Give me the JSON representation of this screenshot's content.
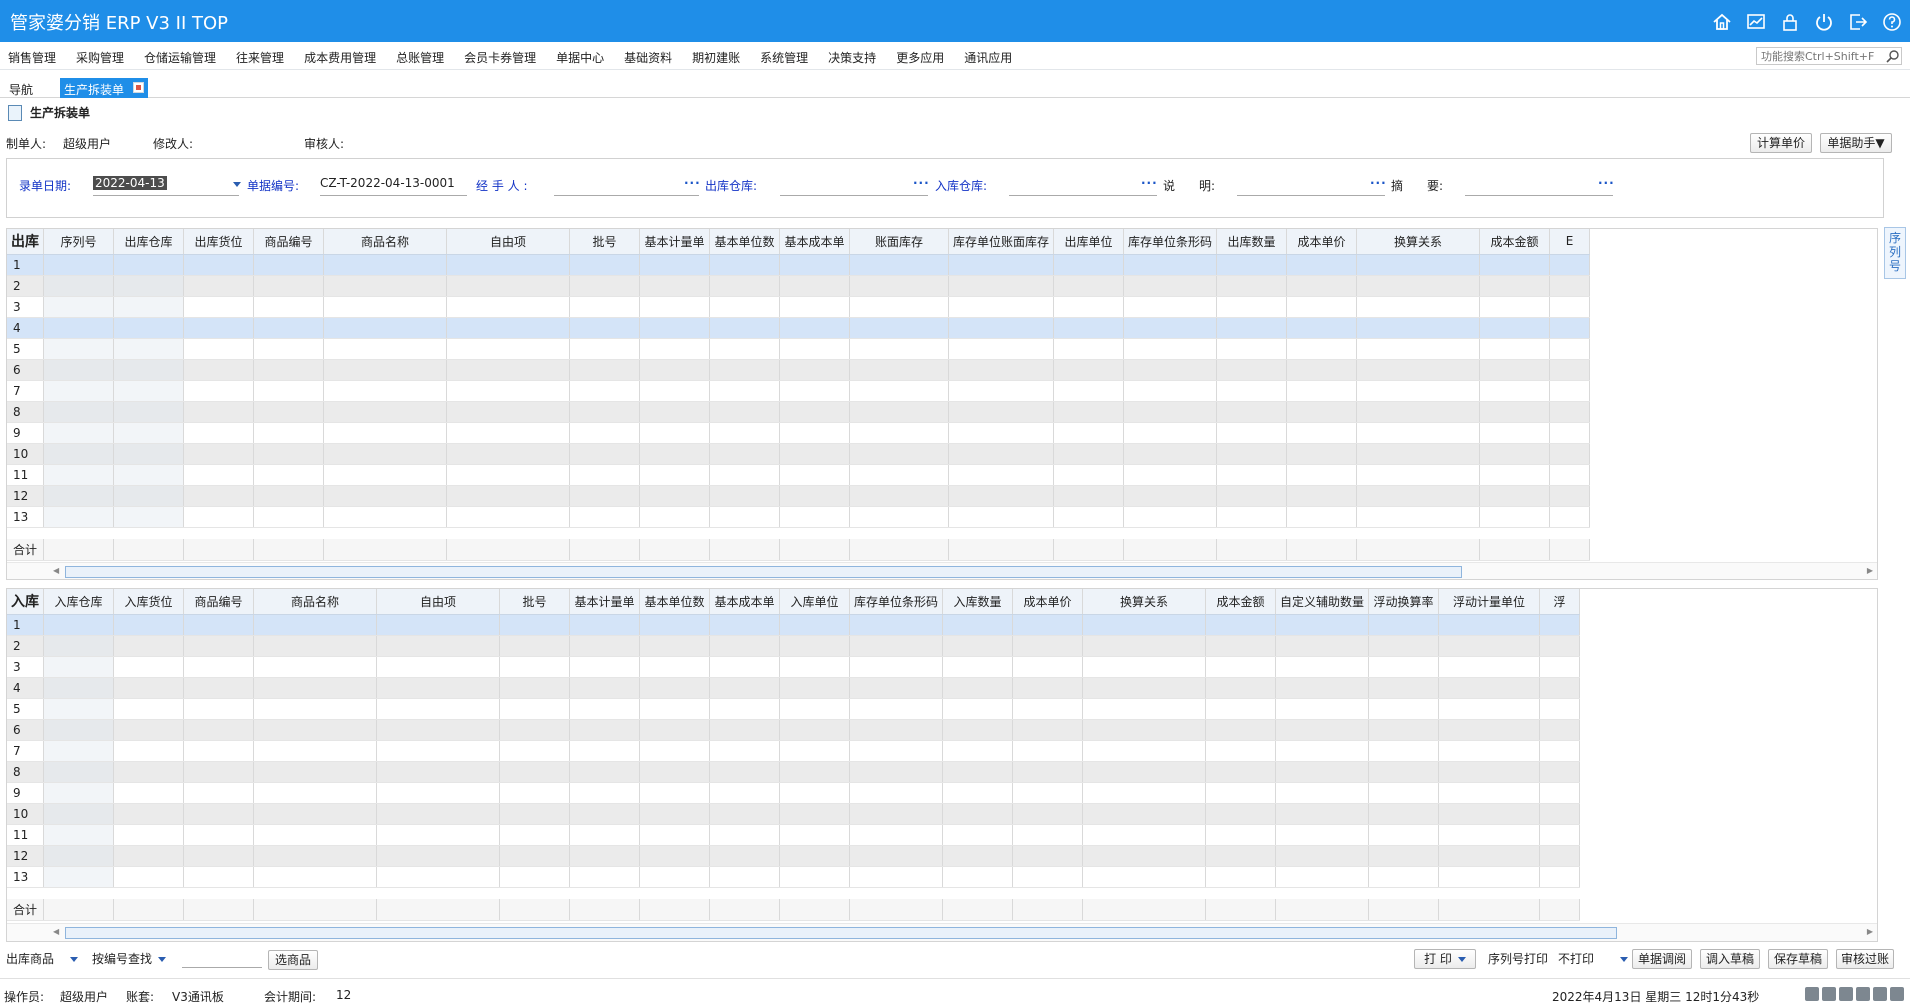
{
  "app": {
    "title": "管家婆分销 ERP V3 II TOP"
  },
  "toolbar_icons": [
    "home-icon",
    "chart-icon",
    "lock-icon",
    "power-icon",
    "logout-icon",
    "help-icon"
  ],
  "menu": [
    "销售管理",
    "采购管理",
    "仓储运输管理",
    "往来管理",
    "成本费用管理",
    "总账管理",
    "会员卡券管理",
    "单据中心",
    "基础资料",
    "期初建账",
    "系统管理",
    "决策支持",
    "更多应用",
    "通讯应用"
  ],
  "search": {
    "placeholder": "功能搜索Ctrl+Shift+F"
  },
  "tabs": {
    "nav": "导航",
    "active": "生产拆装单"
  },
  "doc": {
    "title": "生产拆装单"
  },
  "info": {
    "creator_label": "制单人:",
    "creator": "超级用户",
    "modifier_label": "修改人:",
    "modifier": "",
    "auditor_label": "审核人:",
    "auditor": ""
  },
  "buttons": {
    "calc_price": "计算单价",
    "doc_helper": "单据助手▼"
  },
  "form": {
    "date_label": "录单日期:",
    "date": "2022-04-13",
    "docno_label": "单据编号:",
    "docno": "CZ-T-2022-04-13-0001",
    "handler_label": "经 手 人 :",
    "handler": "",
    "out_wh_label": "出库仓库:",
    "out_wh": "",
    "in_wh_label": "入库仓库:",
    "in_wh": "",
    "note_label": "说　　明:",
    "note": "",
    "summary_label": "摘　　要:",
    "summary": ""
  },
  "out_grid": {
    "corner": "出库",
    "columns": [
      "序列号",
      "出库仓库",
      "出库货位",
      "商品编号",
      "商品名称",
      "自由项",
      "批号",
      "基本计量单",
      "基本单位数",
      "基本成本单",
      "账面库存",
      "库存单位账面库存",
      "出库单位",
      "库存单位条形码",
      "出库数量",
      "成本单价",
      "换算关系",
      "成本金额",
      "E"
    ],
    "rows": [
      "1",
      "2",
      "3",
      "4",
      "5",
      "6",
      "7",
      "8",
      "9",
      "10",
      "11",
      "12",
      "13"
    ],
    "total": "合计"
  },
  "in_grid": {
    "corner": "入库",
    "columns": [
      "入库仓库",
      "入库货位",
      "商品编号",
      "商品名称",
      "自由项",
      "批号",
      "基本计量单",
      "基本单位数",
      "基本成本单",
      "入库单位",
      "库存单位条形码",
      "入库数量",
      "成本单价",
      "换算关系",
      "成本金额",
      "自定义辅助数量",
      "浮动换算率",
      "浮动计量单位",
      "浮"
    ],
    "rows": [
      "1",
      "2",
      "3",
      "4",
      "5",
      "6",
      "7",
      "8",
      "9",
      "10",
      "11",
      "12",
      "13"
    ],
    "total": "合计"
  },
  "side_tab": "序列号",
  "bottom": {
    "goods_select": "出库商品",
    "search_select": "按编号查找",
    "select_goods_btn": "选商品",
    "print_btn": "打 印",
    "serial_print_label": "序列号打印",
    "serial_print_value": "不打印",
    "btn_review": "单据调阅",
    "btn_load_draft": "调入草稿",
    "btn_save_draft": "保存草稿",
    "btn_audit": "审核过账"
  },
  "status": {
    "operator_label": "操作员:",
    "operator": "超级用户",
    "account_label": "账套:",
    "account": "V3通讯板",
    "period_label": "会计期间:",
    "period": "12",
    "datetime": "2022年4月13日  星期三  12时1分43秒"
  }
}
